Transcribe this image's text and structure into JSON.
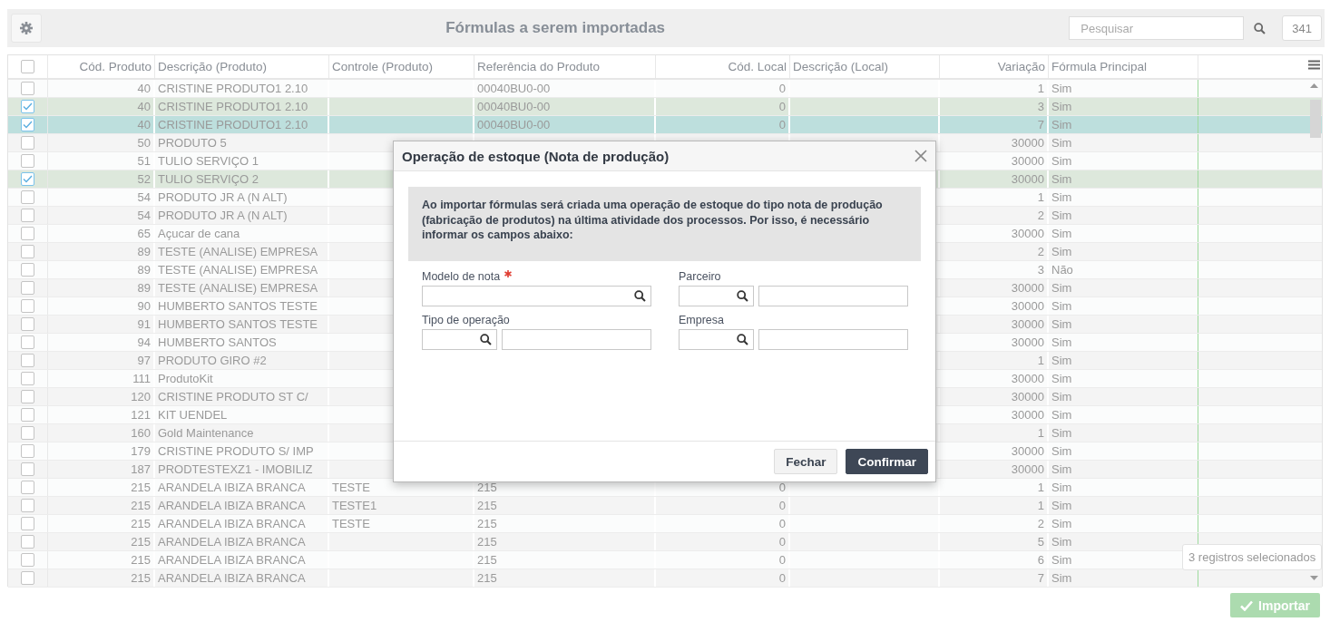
{
  "toolbar": {
    "title": "Fórmulas a serem importadas",
    "search": {
      "placeholder": "Pesquisar"
    },
    "count": "341"
  },
  "table": {
    "columns": [
      "Cód. Produto",
      "Descrição (Produto)",
      "Controle (Produto)",
      "Referência do Produto",
      "Cód. Local",
      "Descrição (Local)",
      "Variação",
      "Fórmula Principal"
    ],
    "all_checked": false,
    "rows": [
      {
        "cod": "40",
        "descricao": "CRISTINE PRODUTO1 2.10",
        "referencia": "00040BU0-00",
        "cod_local": "0",
        "variacao": "1",
        "formula": "Sim",
        "checked": false,
        "focused": false
      },
      {
        "cod": "40",
        "descricao": "CRISTINE PRODUTO1 2.10",
        "referencia": "00040BU0-00",
        "cod_local": "0",
        "variacao": "3",
        "formula": "Sim",
        "checked": true,
        "focused": false
      },
      {
        "cod": "40",
        "descricao": "CRISTINE PRODUTO1 2.10",
        "referencia": "00040BU0-00",
        "cod_local": "0",
        "variacao": "7",
        "formula": "Sim",
        "checked": true,
        "focused": true
      },
      {
        "cod": "50",
        "descricao": "PRODUTO 5",
        "variacao": "30000",
        "formula": "Sim",
        "checked": false,
        "focused": false
      },
      {
        "cod": "51",
        "descricao": "TULIO SERVIÇO 1",
        "variacao": "30000",
        "formula": "Sim",
        "checked": false,
        "focused": false
      },
      {
        "cod": "52",
        "descricao": "TULIO SERVIÇO 2",
        "variacao": "30000",
        "formula": "Sim",
        "checked": true,
        "focused": false
      },
      {
        "cod": "54",
        "descricao": "PRODUTO JR A (N ALT)",
        "variacao": "1",
        "formula": "Sim",
        "checked": false,
        "focused": false
      },
      {
        "cod": "54",
        "descricao": "PRODUTO JR A (N ALT)",
        "variacao": "2",
        "formula": "Sim",
        "checked": false,
        "focused": false
      },
      {
        "cod": "65",
        "descricao": "Açucar de cana",
        "variacao": "30000",
        "formula": "Sim",
        "checked": false,
        "focused": false
      },
      {
        "cod": "89",
        "descricao": "TESTE (ANALISE) EMPRESA",
        "variacao": "2",
        "formula": "Sim",
        "checked": false,
        "focused": false
      },
      {
        "cod": "89",
        "descricao": "TESTE (ANALISE) EMPRESA",
        "variacao": "3",
        "formula": "Não",
        "checked": false,
        "focused": false
      },
      {
        "cod": "89",
        "descricao": "TESTE (ANALISE) EMPRESA",
        "variacao": "30000",
        "formula": "Sim",
        "checked": false,
        "focused": false
      },
      {
        "cod": "90",
        "descricao": "HUMBERTO SANTOS TESTE",
        "variacao": "30000",
        "formula": "Sim",
        "checked": false,
        "focused": false
      },
      {
        "cod": "91",
        "descricao": "HUMBERTO SANTOS TESTE",
        "variacao": "30000",
        "formula": "Sim",
        "checked": false,
        "focused": false
      },
      {
        "cod": "94",
        "descricao": "HUMBERTO SANTOS",
        "variacao": "30000",
        "formula": "Sim",
        "checked": false,
        "focused": false
      },
      {
        "cod": "97",
        "descricao": "PRODUTO GIRO #2",
        "variacao": "1",
        "formula": "Sim",
        "checked": false,
        "focused": false
      },
      {
        "cod": "111",
        "descricao": "ProdutoKit",
        "variacao": "30000",
        "formula": "Sim",
        "checked": false,
        "focused": false
      },
      {
        "cod": "120",
        "descricao": "CRISTINE PRODUTO ST C/",
        "variacao": "30000",
        "formula": "Sim",
        "checked": false,
        "focused": false
      },
      {
        "cod": "121",
        "descricao": "KIT UENDEL",
        "variacao": "30000",
        "formula": "Sim",
        "checked": false,
        "focused": false
      },
      {
        "cod": "160",
        "descricao": "Gold Maintenance",
        "variacao": "1",
        "formula": "Sim",
        "checked": false,
        "focused": false
      },
      {
        "cod": "179",
        "descricao": "CRISTINE PRODUTO S/ IMP",
        "variacao": "30000",
        "formula": "Sim",
        "checked": false,
        "focused": false
      },
      {
        "cod": "187",
        "descricao": "PRODTESTEXZ1 - IMOBILIZ",
        "variacao": "30000",
        "formula": "Sim",
        "checked": false,
        "focused": false
      },
      {
        "cod": "215",
        "descricao": "ARANDELA IBIZA BRANCA",
        "controle": "TESTE",
        "referencia": "215",
        "cod_local": "0",
        "variacao": "1",
        "formula": "Sim",
        "checked": false,
        "focused": false
      },
      {
        "cod": "215",
        "descricao": "ARANDELA IBIZA BRANCA",
        "controle": "TESTE1",
        "referencia": "215",
        "cod_local": "0",
        "variacao": "1",
        "formula": "Sim",
        "checked": false,
        "focused": false
      },
      {
        "cod": "215",
        "descricao": "ARANDELA IBIZA BRANCA",
        "controle": "TESTE",
        "referencia": "215",
        "cod_local": "0",
        "variacao": "2",
        "formula": "Sim",
        "checked": false,
        "focused": false
      },
      {
        "cod": "215",
        "descricao": "ARANDELA IBIZA BRANCA",
        "referencia": "215",
        "cod_local": "0",
        "variacao": "5",
        "formula": "Sim",
        "checked": false,
        "focused": false
      },
      {
        "cod": "215",
        "descricao": "ARANDELA IBIZA BRANCA",
        "referencia": "215",
        "cod_local": "0",
        "variacao": "6",
        "formula": "Sim",
        "checked": false,
        "focused": false
      },
      {
        "cod": "215",
        "descricao": "ARANDELA IBIZA BRANCA",
        "referencia": "215",
        "cod_local": "0",
        "variacao": "7",
        "formula": "Sim",
        "checked": false,
        "focused": false
      }
    ]
  },
  "selection_tooltip": "3 registros selecionados",
  "import_button": {
    "label": "Importar",
    "disabled": true
  },
  "dialog": {
    "title": "Operação de estoque (Nota de produção)",
    "message": "Ao importar fórmulas será criada uma operação de estoque do tipo nota de produção (fabricação de produtos) na última atividade dos processos. Por isso, é necessário informar os campos abaixo:",
    "fields": [
      {
        "label": "Modelo de nota",
        "kind": "single",
        "required": true
      },
      {
        "label": "Parceiro",
        "kind": "pair",
        "required": false
      },
      {
        "label": "Tipo de operação",
        "kind": "pair",
        "required": false
      },
      {
        "label": "Empresa",
        "kind": "pair",
        "required": false
      }
    ],
    "buttons": [
      {
        "label": "Fechar",
        "kind": "secondary"
      },
      {
        "label": "Confirmar",
        "kind": "primary"
      }
    ]
  }
}
